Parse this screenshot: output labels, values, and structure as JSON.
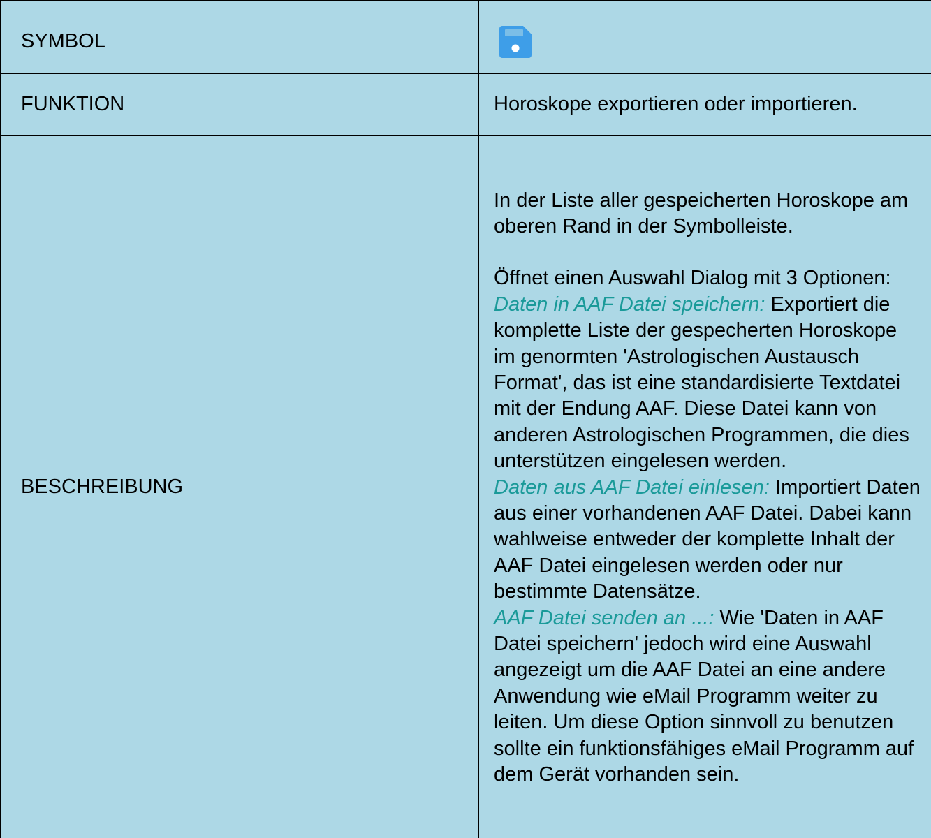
{
  "colors": {
    "table_background": "#add8e6",
    "border": "#000000",
    "text": "#000000",
    "option_name": "#1a9a99",
    "icon_primary": "#3e9ee8",
    "icon_detail": "#ffffff"
  },
  "heading": {
    "part_a": "",
    "part_b": "",
    "note": ""
  },
  "table": {
    "rows": [
      {
        "label": "SYMBOL",
        "icon": "save-floppy-icon"
      },
      {
        "label": "FUNKTION",
        "value": "Horoskope exportieren oder importieren."
      },
      {
        "label": "BESCHREIBUNG",
        "intro": "In der Liste aller gespeicherten Horoskope am oberen Rand in der Symbolleiste.",
        "dialog_line": "Öffnet einen Auswahl Dialog mit 3 Optionen:",
        "options": [
          {
            "name": "Daten in AAF Datei speichern:",
            "text": " Exportiert die komplette Liste der gespecherten Horoskope im genormten 'Astrologischen Austausch Format', das ist eine standardisierte Textdatei mit der Endung AAF. Diese Datei kann von anderen Astrologischen Programmen, die dies unterstützen eingelesen werden."
          },
          {
            "name": "Daten aus AAF Datei einlesen:",
            "text": " Importiert Daten aus einer vorhandenen AAF Datei. Dabei kann wahlweise entweder der komplette Inhalt der AAF Datei eingelesen werden oder nur bestimmte Datensätze."
          },
          {
            "name": "AAF Datei senden an ...:",
            "text": " Wie 'Daten in AAF Datei speichern' jedoch wird eine Auswahl angezeigt um die AAF Datei an eine andere Anwendung wie eMail Programm weiter zu leiten. Um diese Option sinnvoll zu benutzen sollte ein funktionsfähiges eMail Programm auf dem Gerät vorhanden sein."
          }
        ]
      }
    ]
  }
}
